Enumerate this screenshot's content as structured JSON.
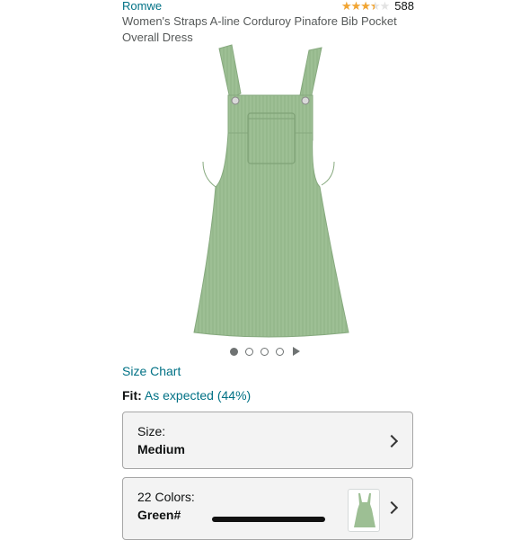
{
  "product": {
    "brand": "Romwe",
    "rating": {
      "stars": 3.5,
      "max": 5,
      "count": "588"
    },
    "title": "Women's Straps A-line Corduroy Pinafore Bib Pocket Overall Dress",
    "image": {
      "icon": "green-corduroy-overall-dress",
      "color": "#9dbf94"
    }
  },
  "carousel": {
    "dot_count": 4,
    "active_index": 0,
    "has_video": true
  },
  "size_chart": {
    "label": "Size Chart"
  },
  "fit": {
    "label": "Fit:",
    "value": "As expected (44%)"
  },
  "size_selector": {
    "label": "Size:",
    "value": "Medium"
  },
  "color_selector": {
    "label": "22 Colors:",
    "value": "Green#"
  },
  "colors": {
    "link": "#007185",
    "star": "#f2a532",
    "dress": "#9dbf94",
    "panel": "#f3f3f3"
  }
}
